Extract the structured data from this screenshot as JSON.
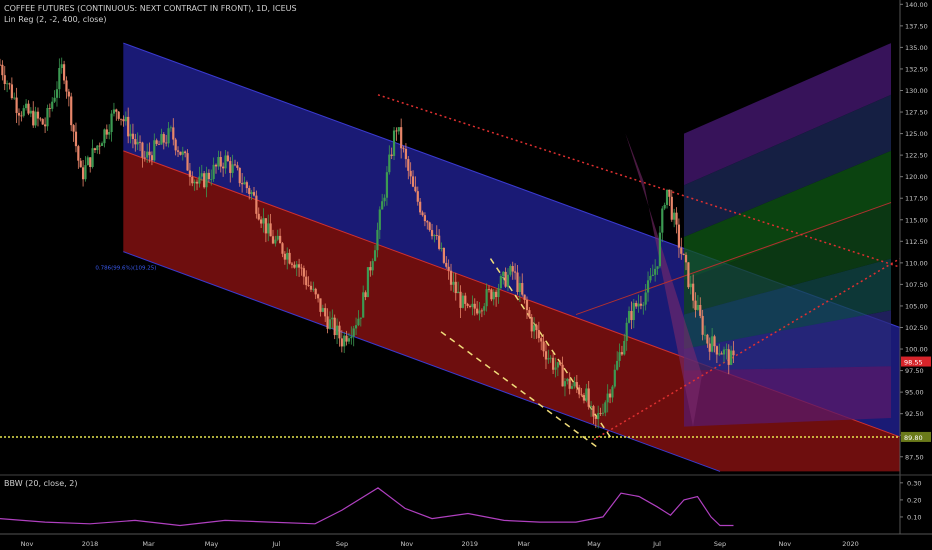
{
  "header": {
    "title": "COFFEE FUTURES (CONTINUOUS: NEXT CONTRACT IN FRONT), 1D, ICEUS",
    "indicator": "Lin Reg (2, -2, 400, close)"
  },
  "subpanel": {
    "label": "BBW (20, close, 2)",
    "ticks": [
      "0.30",
      "0.20",
      "0.10"
    ]
  },
  "annotation_label": "0.786(99.6%)(109.25)",
  "colors": {
    "background": "#000000",
    "upper_channel": "#1f1f8a",
    "lower_channel": "#7a0f0f",
    "candle_up": "#3c9a52",
    "candle_down": "#e8866a",
    "dotted_red": "#e03030",
    "dashed_yellow": "#f0dc7a",
    "support_line": "#e6e650",
    "bbw_line": "#b040c0",
    "price_badge": "#d6242a",
    "support_badge": "#6a7a1a"
  },
  "chart_data": {
    "type": "candlestick",
    "title": "COFFEE FUTURES (CONTINUOUS: NEXT CONTRACT IN FRONT), 1D, ICEUS",
    "x_ticks": [
      "Nov",
      "2018",
      "Mar",
      "May",
      "Jul",
      "Sep",
      "Nov",
      "2019",
      "Mar",
      "May",
      "Jul",
      "Sep",
      "Nov",
      "2020"
    ],
    "y_ticks": [
      140,
      137.5,
      135,
      132.5,
      130,
      127.5,
      125,
      122.5,
      120,
      117.5,
      115,
      112.5,
      110,
      107.5,
      105,
      102.5,
      100,
      97.5,
      95,
      92.5,
      90,
      87.5
    ],
    "ylim": [
      85.5,
      140.5
    ],
    "last_price": 98.55,
    "support_level": 89.8,
    "price_path": [
      [
        0,
        133
      ],
      [
        0.02,
        128
      ],
      [
        0.05,
        126
      ],
      [
        0.07,
        133
      ],
      [
        0.09,
        120
      ],
      [
        0.11,
        124
      ],
      [
        0.13,
        128
      ],
      [
        0.16,
        122
      ],
      [
        0.19,
        125
      ],
      [
        0.22,
        119
      ],
      [
        0.25,
        122
      ],
      [
        0.28,
        118
      ],
      [
        0.3,
        113
      ],
      [
        0.33,
        110
      ],
      [
        0.36,
        104
      ],
      [
        0.38,
        101
      ],
      [
        0.4,
        104
      ],
      [
        0.42,
        114
      ],
      [
        0.44,
        126
      ],
      [
        0.46,
        118
      ],
      [
        0.48,
        114
      ],
      [
        0.5,
        108
      ],
      [
        0.52,
        104
      ],
      [
        0.55,
        107
      ],
      [
        0.57,
        109
      ],
      [
        0.59,
        103
      ],
      [
        0.61,
        99
      ],
      [
        0.63,
        96
      ],
      [
        0.65,
        95
      ],
      [
        0.66,
        91
      ],
      [
        0.68,
        96
      ],
      [
        0.7,
        104
      ],
      [
        0.72,
        107
      ],
      [
        0.73,
        110
      ],
      [
        0.74,
        119
      ],
      [
        0.755,
        112
      ],
      [
        0.77,
        106
      ],
      [
        0.785,
        101
      ],
      [
        0.8,
        100
      ],
      [
        0.815,
        98.5
      ]
    ],
    "bbw_path": [
      [
        0,
        0.09
      ],
      [
        0.05,
        0.07
      ],
      [
        0.1,
        0.06
      ],
      [
        0.15,
        0.08
      ],
      [
        0.2,
        0.05
      ],
      [
        0.25,
        0.08
      ],
      [
        0.3,
        0.07
      ],
      [
        0.35,
        0.06
      ],
      [
        0.38,
        0.14
      ],
      [
        0.42,
        0.27
      ],
      [
        0.45,
        0.15
      ],
      [
        0.48,
        0.09
      ],
      [
        0.52,
        0.12
      ],
      [
        0.56,
        0.08
      ],
      [
        0.6,
        0.07
      ],
      [
        0.64,
        0.07
      ],
      [
        0.67,
        0.1
      ],
      [
        0.69,
        0.24
      ],
      [
        0.71,
        0.22
      ],
      [
        0.73,
        0.16
      ],
      [
        0.745,
        0.11
      ],
      [
        0.76,
        0.2
      ],
      [
        0.775,
        0.22
      ],
      [
        0.79,
        0.1
      ],
      [
        0.8,
        0.05
      ],
      [
        0.815,
        0.05
      ]
    ],
    "bbw_ylim": [
      0.0,
      0.34
    ]
  }
}
